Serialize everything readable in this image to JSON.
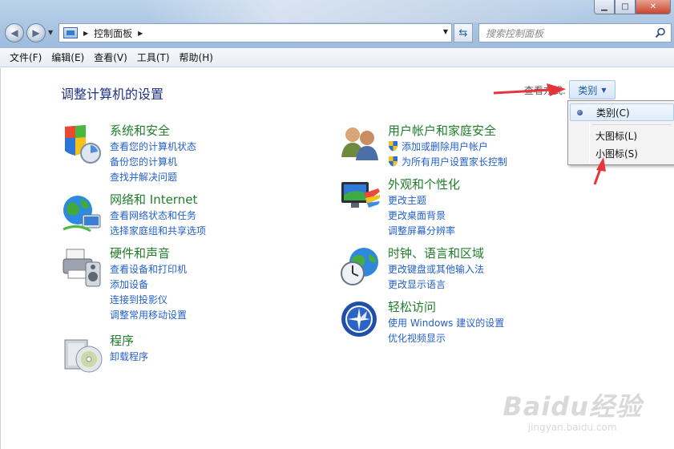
{
  "window": {
    "minimize_glyph": "▁",
    "maximize_glyph": "□",
    "close_glyph": "✕"
  },
  "address_bar": {
    "crumb": "控制面板",
    "search_placeholder": "搜索控制面板"
  },
  "menu": [
    "文件(F)",
    "编辑(E)",
    "查看(V)",
    "工具(T)",
    "帮助(H)"
  ],
  "main": {
    "title": "调整计算机的设置",
    "view_by_label": "查看方式:",
    "view_button": "类别"
  },
  "view_dropdown": {
    "items": [
      "类别(C)",
      "大图标(L)",
      "小图标(S)"
    ],
    "selected": "类别(C)"
  },
  "categories": [
    {
      "title": "系统和安全",
      "icon": "shield-icon",
      "links": [
        "查看您的计算机状态",
        "备份您的计算机",
        "查找并解决问题"
      ]
    },
    {
      "title": "网络和 Internet",
      "icon": "network-globe-icon",
      "links": [
        "查看网络状态和任务",
        "选择家庭组和共享选项"
      ]
    },
    {
      "title": "硬件和声音",
      "icon": "printer-speaker-icon",
      "links": [
        "查看设备和打印机",
        "添加设备",
        "连接到投影仪",
        "调整常用移动设置"
      ]
    },
    {
      "title": "程序",
      "icon": "programs-disc-icon",
      "links": [
        "卸载程序"
      ]
    },
    {
      "title": "用户帐户和家庭安全",
      "icon": "users-icon",
      "links": [
        "添加或删除用户帐户",
        "为所有用户设置家长控制"
      ]
    },
    {
      "title": "外观和个性化",
      "icon": "appearance-monitor-icon",
      "links": [
        "更改主题",
        "更改桌面背景",
        "调整屏幕分辨率"
      ]
    },
    {
      "title": "时钟、语言和区域",
      "icon": "clock-globe-icon",
      "links": [
        "更改键盘或其他输入法",
        "更改显示语言"
      ]
    },
    {
      "title": "轻松访问",
      "icon": "ease-of-access-icon",
      "links": [
        "使用 Windows 建议的设置",
        "优化视频显示"
      ]
    }
  ],
  "annotation_color": "#e8333a",
  "link_color": "#2461c8",
  "category_title_color": "#1f7e2a",
  "watermark": {
    "brand": "Baidu经验",
    "url": "jingyan.baidu.com"
  }
}
